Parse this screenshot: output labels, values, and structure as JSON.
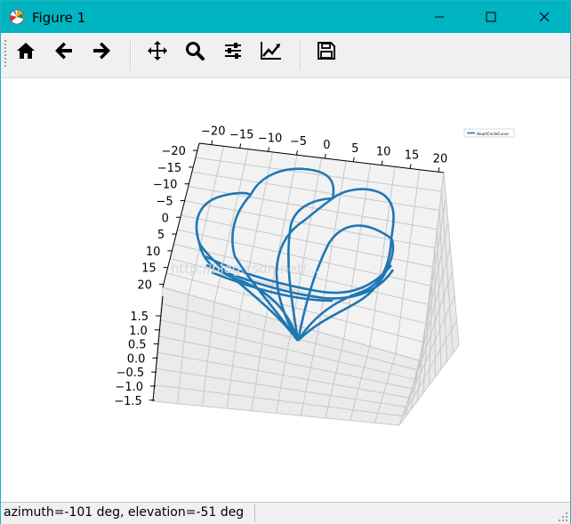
{
  "window": {
    "title": "Figure 1"
  },
  "toolbar": {
    "buttons": [
      {
        "name": "home",
        "icon": "home-icon"
      },
      {
        "name": "back",
        "icon": "arrow-left-icon"
      },
      {
        "name": "forward",
        "icon": "arrow-right-icon"
      },
      {
        "name": "pan",
        "icon": "move-icon"
      },
      {
        "name": "zoom",
        "icon": "search-icon"
      },
      {
        "name": "subplots",
        "icon": "sliders-icon"
      },
      {
        "name": "customize",
        "icon": "line-chart-icon"
      },
      {
        "name": "save",
        "icon": "floppy-disk-icon"
      }
    ]
  },
  "plot": {
    "legend_label": "HeartCircleCurve",
    "line_color": "#1f77b4",
    "x_ticks": [
      "−20",
      "−15",
      "−10",
      "−5",
      "0",
      "5",
      "10",
      "15",
      "20"
    ],
    "y_ticks": [
      "−20",
      "−15",
      "−10",
      "−5",
      "0",
      "5",
      "10",
      "15",
      "20"
    ],
    "z_ticks": [
      "1.5",
      "1.0",
      "0.5",
      "0.0",
      "−0.5",
      "−1.0",
      "−1.5"
    ],
    "watermark": "http://blog.csdn.net/..."
  },
  "status": {
    "text": "azimuth=-101 deg, elevation=-51 deg"
  },
  "colors": {
    "titlebar": "#00b4c1",
    "toolbar": "#f0f0f0",
    "line": "#1f77b4"
  }
}
